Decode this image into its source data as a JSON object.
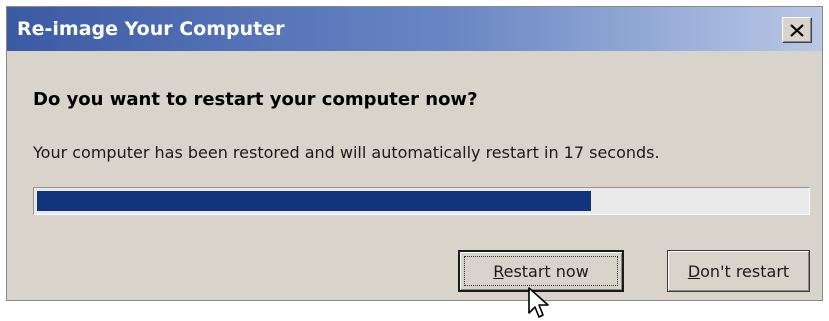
{
  "window": {
    "title": "Re-image Your Computer",
    "close_label": "X"
  },
  "dialog": {
    "heading": "Do you want to restart your computer now?",
    "message": "Your computer has been restored and will automatically restart in 17 seconds.",
    "countdown_seconds": 17,
    "progress_fraction": 0.72
  },
  "buttons": {
    "restart_now": {
      "mnemonic": "R",
      "rest": "estart now"
    },
    "dont_restart": {
      "mnemonic": "D",
      "rest": "on't restart"
    }
  },
  "colors": {
    "titlebar_start": "#3b5aa4",
    "titlebar_end": "#b9c8e6",
    "dialog_bg": "#d8d3cb",
    "progress_fill": "#12347f"
  },
  "icons": {
    "close": "close-icon",
    "cursor": "mouse-pointer-icon"
  }
}
